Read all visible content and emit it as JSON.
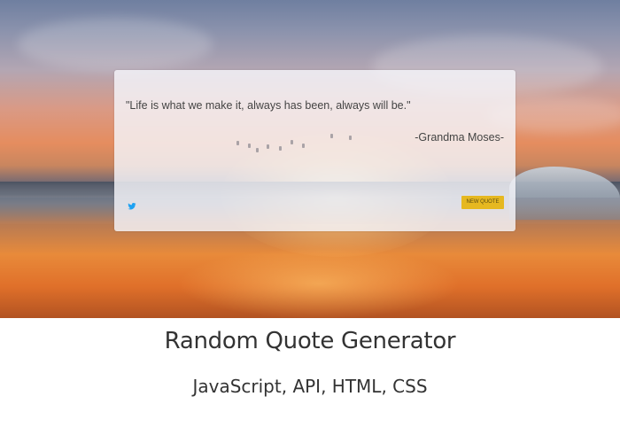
{
  "quote": {
    "text": "\"Life is what we make it, always has been, always will be.\"",
    "author": "-Grandma Moses-",
    "tweet_icon": "twitter-bird-icon",
    "new_quote_label": "NEW QUOTE"
  },
  "caption": {
    "title": "Random Quote Generator",
    "subtitle": "JavaScript, API, HTML, CSS"
  },
  "colors": {
    "button_bg": "#e6b820",
    "twitter_blue": "#1da1f2",
    "text": "#333333"
  }
}
